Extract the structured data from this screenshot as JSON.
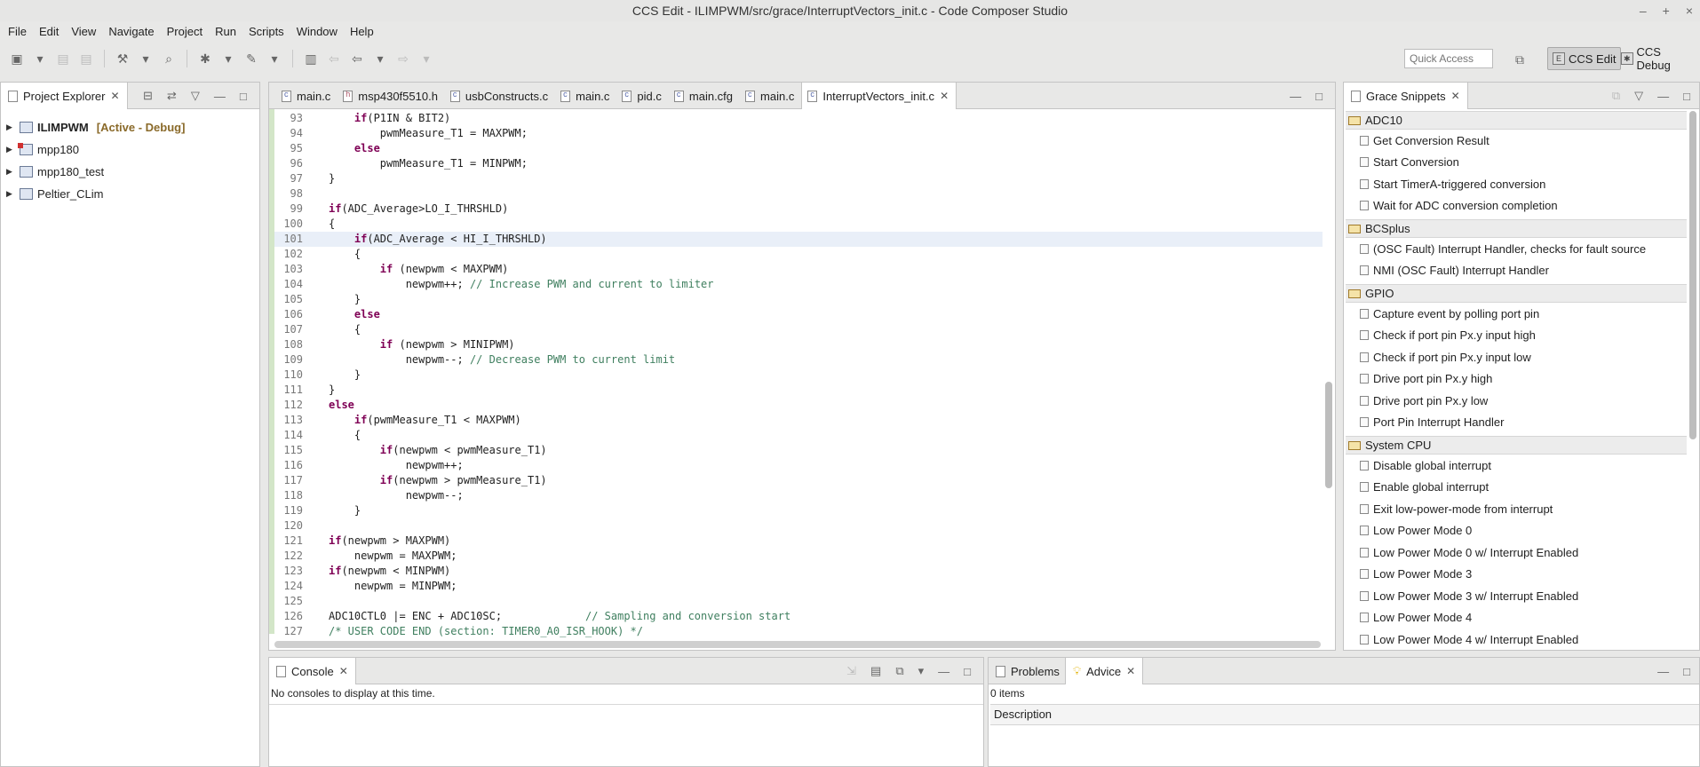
{
  "window": {
    "title": "CCS Edit - ILIMPWM/src/grace/InterruptVectors_init.c - Code Composer Studio"
  },
  "menu": [
    "File",
    "Edit",
    "View",
    "Navigate",
    "Project",
    "Run",
    "Scripts",
    "Window",
    "Help"
  ],
  "toolbar": {
    "quick_access_placeholder": "Quick Access"
  },
  "perspectives": {
    "edit": "CCS Edit",
    "debug": "CCS Debug"
  },
  "project_explorer": {
    "title": "Project Explorer",
    "projects": [
      {
        "name": "ILIMPWM",
        "status": "[Active - Debug]"
      },
      {
        "name": "mpp180",
        "status": ""
      },
      {
        "name": "mpp180_test",
        "status": ""
      },
      {
        "name": "Peltier_CLim",
        "status": ""
      }
    ]
  },
  "editor": {
    "tabs": [
      "main.c",
      "msp430f5510.h",
      "usbConstructs.c",
      "main.c",
      "pid.c",
      "main.cfg",
      "main.c",
      "InterruptVectors_init.c"
    ],
    "active_tab": "InterruptVectors_init.c",
    "lines": [
      {
        "n": "93",
        "t": "    if(P1IN & BIT2)"
      },
      {
        "n": "94",
        "t": "        pwmMeasure_T1 = MAXPWM;"
      },
      {
        "n": "95",
        "t": "    else"
      },
      {
        "n": "96",
        "t": "        pwmMeasure_T1 = MINPWM;"
      },
      {
        "n": "97",
        "t": "}"
      },
      {
        "n": "98",
        "t": ""
      },
      {
        "n": "99",
        "t": "if(ADC_Average>LO_I_THRSHLD)"
      },
      {
        "n": "100",
        "t": "{"
      },
      {
        "n": "101",
        "t": "    if(ADC_Average < HI_I_THRSHLD)"
      },
      {
        "n": "102",
        "t": "    {"
      },
      {
        "n": "103",
        "t": "        if (newpwm < MAXPWM)"
      },
      {
        "n": "104",
        "t": "            newpwm++; // Increase PWM and current to limiter"
      },
      {
        "n": "105",
        "t": "    }"
      },
      {
        "n": "106",
        "t": "    else"
      },
      {
        "n": "107",
        "t": "    {"
      },
      {
        "n": "108",
        "t": "        if (newpwm > MINIPWM)"
      },
      {
        "n": "109",
        "t": "            newpwm--; // Decrease PWM to current limit"
      },
      {
        "n": "110",
        "t": "    }"
      },
      {
        "n": "111",
        "t": "}"
      },
      {
        "n": "112",
        "t": "else"
      },
      {
        "n": "113",
        "t": "    if(pwmMeasure_T1 < MAXPWM)"
      },
      {
        "n": "114",
        "t": "    {"
      },
      {
        "n": "115",
        "t": "        if(newpwm < pwmMeasure_T1)"
      },
      {
        "n": "116",
        "t": "            newpwm++;"
      },
      {
        "n": "117",
        "t": "        if(newpwm > pwmMeasure_T1)"
      },
      {
        "n": "118",
        "t": "            newpwm--;"
      },
      {
        "n": "119",
        "t": "    }"
      },
      {
        "n": "120",
        "t": ""
      },
      {
        "n": "121",
        "t": "if(newpwm > MAXPWM)"
      },
      {
        "n": "122",
        "t": "    newpwm = MAXPWM;"
      },
      {
        "n": "123",
        "t": "if(newpwm < MINPWM)"
      },
      {
        "n": "124",
        "t": "    newpwm = MINPWM;"
      },
      {
        "n": "125",
        "t": ""
      },
      {
        "n": "126",
        "t": "ADC10CTL0 |= ENC + ADC10SC;             // Sampling and conversion start"
      },
      {
        "n": "127",
        "t": "/* USER CODE END (section: TIMER0_A0_ISR_HOOK) */"
      }
    ]
  },
  "snippets": {
    "title": "Grace Snippets",
    "sections": [
      {
        "name": "ADC10",
        "items": [
          "Get Conversion Result",
          "Start Conversion",
          "Start TimerA-triggered conversion",
          "Wait for ADC conversion completion"
        ]
      },
      {
        "name": "BCSplus",
        "items": [
          "(OSC Fault) Interrupt Handler, checks for fault source",
          "NMI (OSC Fault) Interrupt Handler"
        ]
      },
      {
        "name": "GPIO",
        "items": [
          "Capture event by polling port pin",
          "Check if port pin Px.y input high",
          "Check if port pin Px.y input low",
          "Drive port pin Px.y high",
          "Drive port pin Px.y low",
          "Port Pin Interrupt Handler"
        ]
      },
      {
        "name": "System CPU",
        "items": [
          "Disable global interrupt",
          "Enable global interrupt",
          "Exit low-power-mode from interrupt",
          "Low Power Mode 0",
          "Low Power Mode 0 w/ Interrupt Enabled",
          "Low Power Mode 3",
          "Low Power Mode 3 w/ Interrupt Enabled",
          "Low Power Mode 4",
          "Low Power Mode 4 w/ Interrupt Enabled"
        ]
      }
    ]
  },
  "console": {
    "title": "Console",
    "message": "No consoles to display at this time."
  },
  "problems": {
    "title": "Problems"
  },
  "advice": {
    "title": "Advice",
    "count": "0 items",
    "column": "Description"
  }
}
